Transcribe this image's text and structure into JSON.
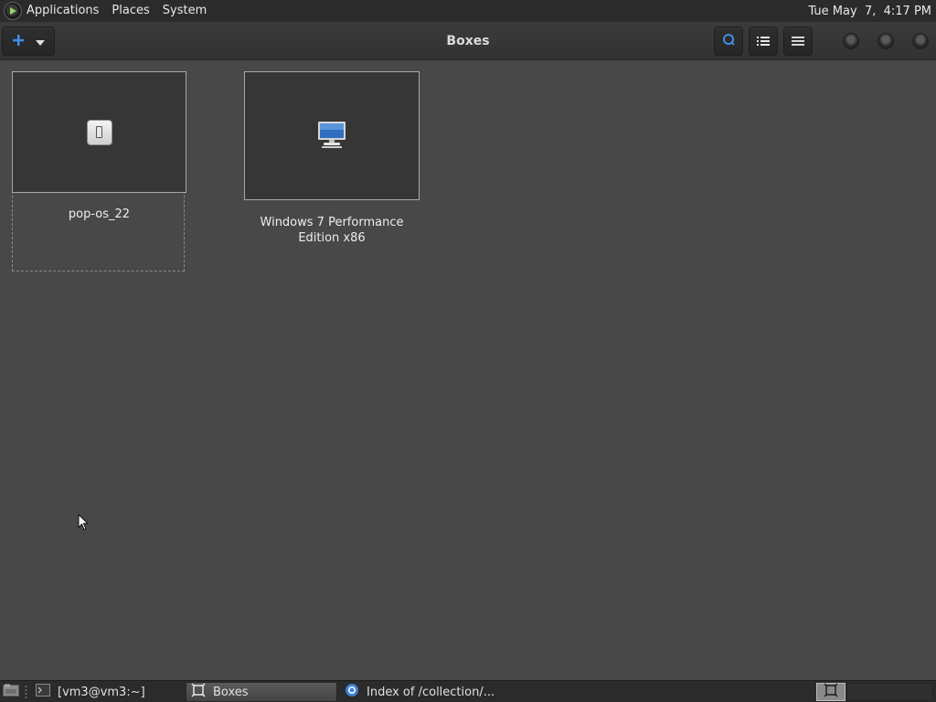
{
  "top_panel": {
    "menus": [
      "Applications",
      "Places",
      "System"
    ],
    "clock": "Tue May  7,  4:17 PM",
    "logo_icon": "play-logo-icon"
  },
  "headerbar": {
    "title": "Boxes",
    "new_button_icon": "plus-icon",
    "new_dropdown_icon": "chevron-down-icon",
    "search_icon": "search-icon",
    "list_icon": "list-view-icon",
    "menu_icon": "hamburger-menu-icon",
    "accent_color": "#3d8ee6"
  },
  "boxes": [
    {
      "name": "pop-os_22",
      "icon": "power-switch-icon",
      "selected": true
    },
    {
      "name_line1": "Windows 7 Performance",
      "name_line2": "Edition x86",
      "icon": "computer-icon",
      "selected": false
    }
  ],
  "bottom_panel": {
    "tasks": [
      {
        "label": "[vm3@vm3:~]",
        "icon": "terminal-icon"
      },
      {
        "label": "Boxes",
        "icon": "boxes-icon",
        "active": true
      },
      {
        "label": "Index of /collection/...",
        "icon": "browser-icon"
      }
    ],
    "show_desktop_icon": "show-desktop-icon",
    "workspace_icon": "boxes-icon"
  }
}
